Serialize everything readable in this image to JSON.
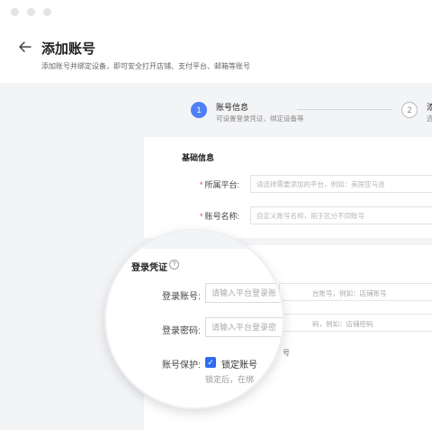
{
  "header": {
    "title": "添加账号",
    "subtitle": "添加账号并绑定设备，即可安全打开店铺、支付平台、邮箱等账号"
  },
  "stepper": {
    "step1": {
      "number": "1",
      "title": "账号信息",
      "desc": "可设置登录凭证、绑定设备等"
    },
    "step2": {
      "number": "2",
      "title": "添",
      "desc": "选"
    }
  },
  "basic_info": {
    "section_title": "基础信息",
    "platform": {
      "label": "所属平台:",
      "placeholder": "请选择需要添加的平台，例如：美国亚马逊"
    },
    "account_name": {
      "label": "账号名称:",
      "placeholder": "自定义账号名称，用于区分不同账号"
    }
  },
  "background_fields": {
    "login_account_placeholder": "台账号，例如：店铺账号",
    "login_password_placeholder": "码，例如：店铺密码",
    "protect_suffix": "号"
  },
  "magnifier": {
    "section_title": "登录凭证",
    "help_icon": "question-circle-icon",
    "login_account": {
      "label": "登录账号:",
      "placeholder": "请输入平台登录账"
    },
    "login_password": {
      "label": "登录密码:",
      "placeholder": "请输入平台登录密"
    },
    "protect": {
      "label": "账号保护:",
      "checkbox_label": "锁定账号",
      "checked": true
    },
    "hint": "锁定后，在绑"
  },
  "colors": {
    "accent": "#4e7ff5",
    "checkbox": "#2f6bf0",
    "required": "#e5484d",
    "background": "#f3f4f6"
  }
}
